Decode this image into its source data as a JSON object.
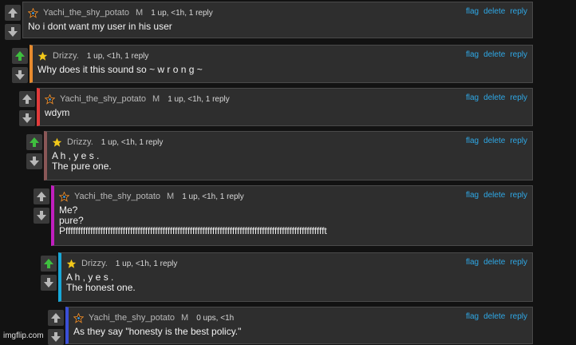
{
  "comments": [
    {
      "username": "Yachi_the_shy_potato",
      "tag": "M",
      "stats": "1 up, <1h, 1 reply",
      "lines": [
        "No i dont want my user in his user"
      ],
      "badge": "badge-dark",
      "bar": "",
      "upvoted": false
    },
    {
      "username": "Drizzy.",
      "tag": "",
      "stats": "1 up, <1h, 1 reply",
      "lines": [
        "Why does it this sound so ~ w r o n g ~"
      ],
      "badge": "badge-star",
      "bar": "#e68a2e",
      "upvoted": true
    },
    {
      "username": "Yachi_the_shy_potato",
      "tag": "M",
      "stats": "1 up, <1h, 1 reply",
      "lines": [
        "wdym"
      ],
      "badge": "badge-dark",
      "bar": "#e23b3b",
      "upvoted": false
    },
    {
      "username": "Drizzy.",
      "tag": "",
      "stats": "1 up, <1h, 1 reply",
      "lines": [
        "A h , y e s .",
        "The pure one."
      ],
      "badge": "badge-star",
      "bar": "#8a5757",
      "upvoted": true
    },
    {
      "username": "Yachi_the_shy_potato",
      "tag": "M",
      "stats": "1 up, <1h, 1 reply",
      "lines": [
        "Me?",
        "pure?",
        "Pfffffffffffffffffffffffffffffffffffffffffffffffffffffffffffffffffffffffffffffffffffffffffffffffffffffffft"
      ],
      "badge": "badge-dark",
      "bar": "#c11fbf",
      "upvoted": false
    },
    {
      "username": "Drizzy.",
      "tag": "",
      "stats": "1 up, <1h, 1 reply",
      "lines": [
        "A h , y e s .",
        "The honest one."
      ],
      "badge": "badge-star",
      "bar": "#17a8d8",
      "upvoted": true
    },
    {
      "username": "Yachi_the_shy_potato",
      "tag": "M",
      "stats": "0 ups, <1h",
      "lines": [
        "As they say \"honesty is the best policy.\""
      ],
      "badge": "badge-dark",
      "bar": "#3a4fd8",
      "upvoted": false
    }
  ],
  "actions": {
    "flag": "flag",
    "delete": "delete",
    "reply": "reply"
  },
  "colors": {
    "upvoted": "#3fbf3f",
    "arrow": "#b8b8b8",
    "link": "#2fa8e6"
  },
  "watermark": "imgflip.com"
}
